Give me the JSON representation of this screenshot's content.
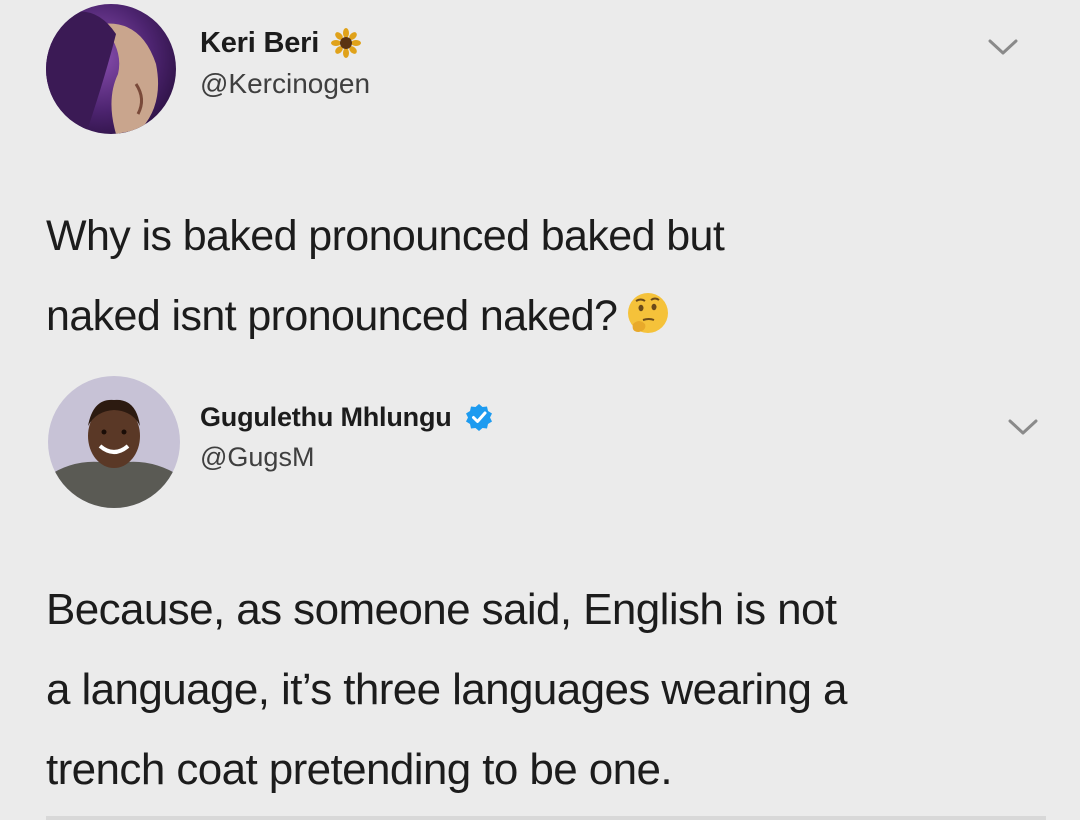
{
  "tweets": [
    {
      "display_name": "Keri Beri",
      "name_icon": "sunflower-icon",
      "handle": "@Kercinogen",
      "text_lines": [
        "Why is baked pronounced baked but",
        "naked isnt pronounced naked?"
      ],
      "text_emoji": "thinking-face-icon",
      "menu_icon": "chevron-down-icon"
    },
    {
      "display_name": "Gugulethu Mhlungu",
      "name_icon": "verified-badge-icon",
      "handle": "@GugsM",
      "text_lines": [
        "Because, as someone said, English is not",
        "a language, it’s three languages wearing a",
        "trench coat pretending to be one."
      ],
      "menu_icon": "chevron-down-icon"
    }
  ],
  "colors": {
    "background": "#ebebeb",
    "verified_blue": "#1d9bf0",
    "text": "#1c1c1c",
    "secondary_text": "#3f3f3f"
  }
}
